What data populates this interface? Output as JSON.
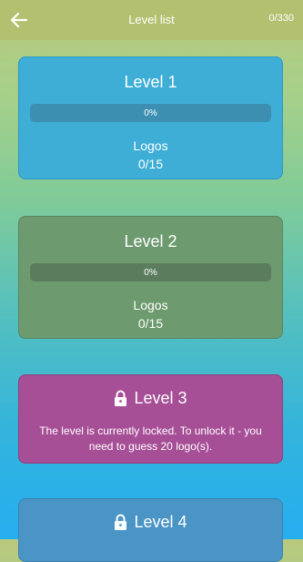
{
  "header": {
    "title": "Level list",
    "counter": "0/330",
    "back_icon": "arrow-left-icon"
  },
  "colors": {
    "header_bg": "#b3c070",
    "level1_card": "#3eaed6",
    "level2_card": "#6d9a6e",
    "level3_card": "#a64f96",
    "level4_card": "#4a95c6"
  },
  "levels": [
    {
      "title": "Level 1",
      "progress": 0,
      "progress_label": "0%",
      "logos_label": "Logos",
      "logos_count": "0/15"
    },
    {
      "title": "Level 2",
      "progress": 0,
      "progress_label": "0%",
      "logos_label": "Logos",
      "logos_count": "0/15"
    },
    {
      "title": "Level 3",
      "locked": true,
      "lock_icon": "lock-icon",
      "locked_message": "The level is currently locked. To unlock it - you need to guess 20 logo(s)."
    },
    {
      "title": "Level 4",
      "locked": true,
      "lock_icon": "lock-icon"
    }
  ]
}
